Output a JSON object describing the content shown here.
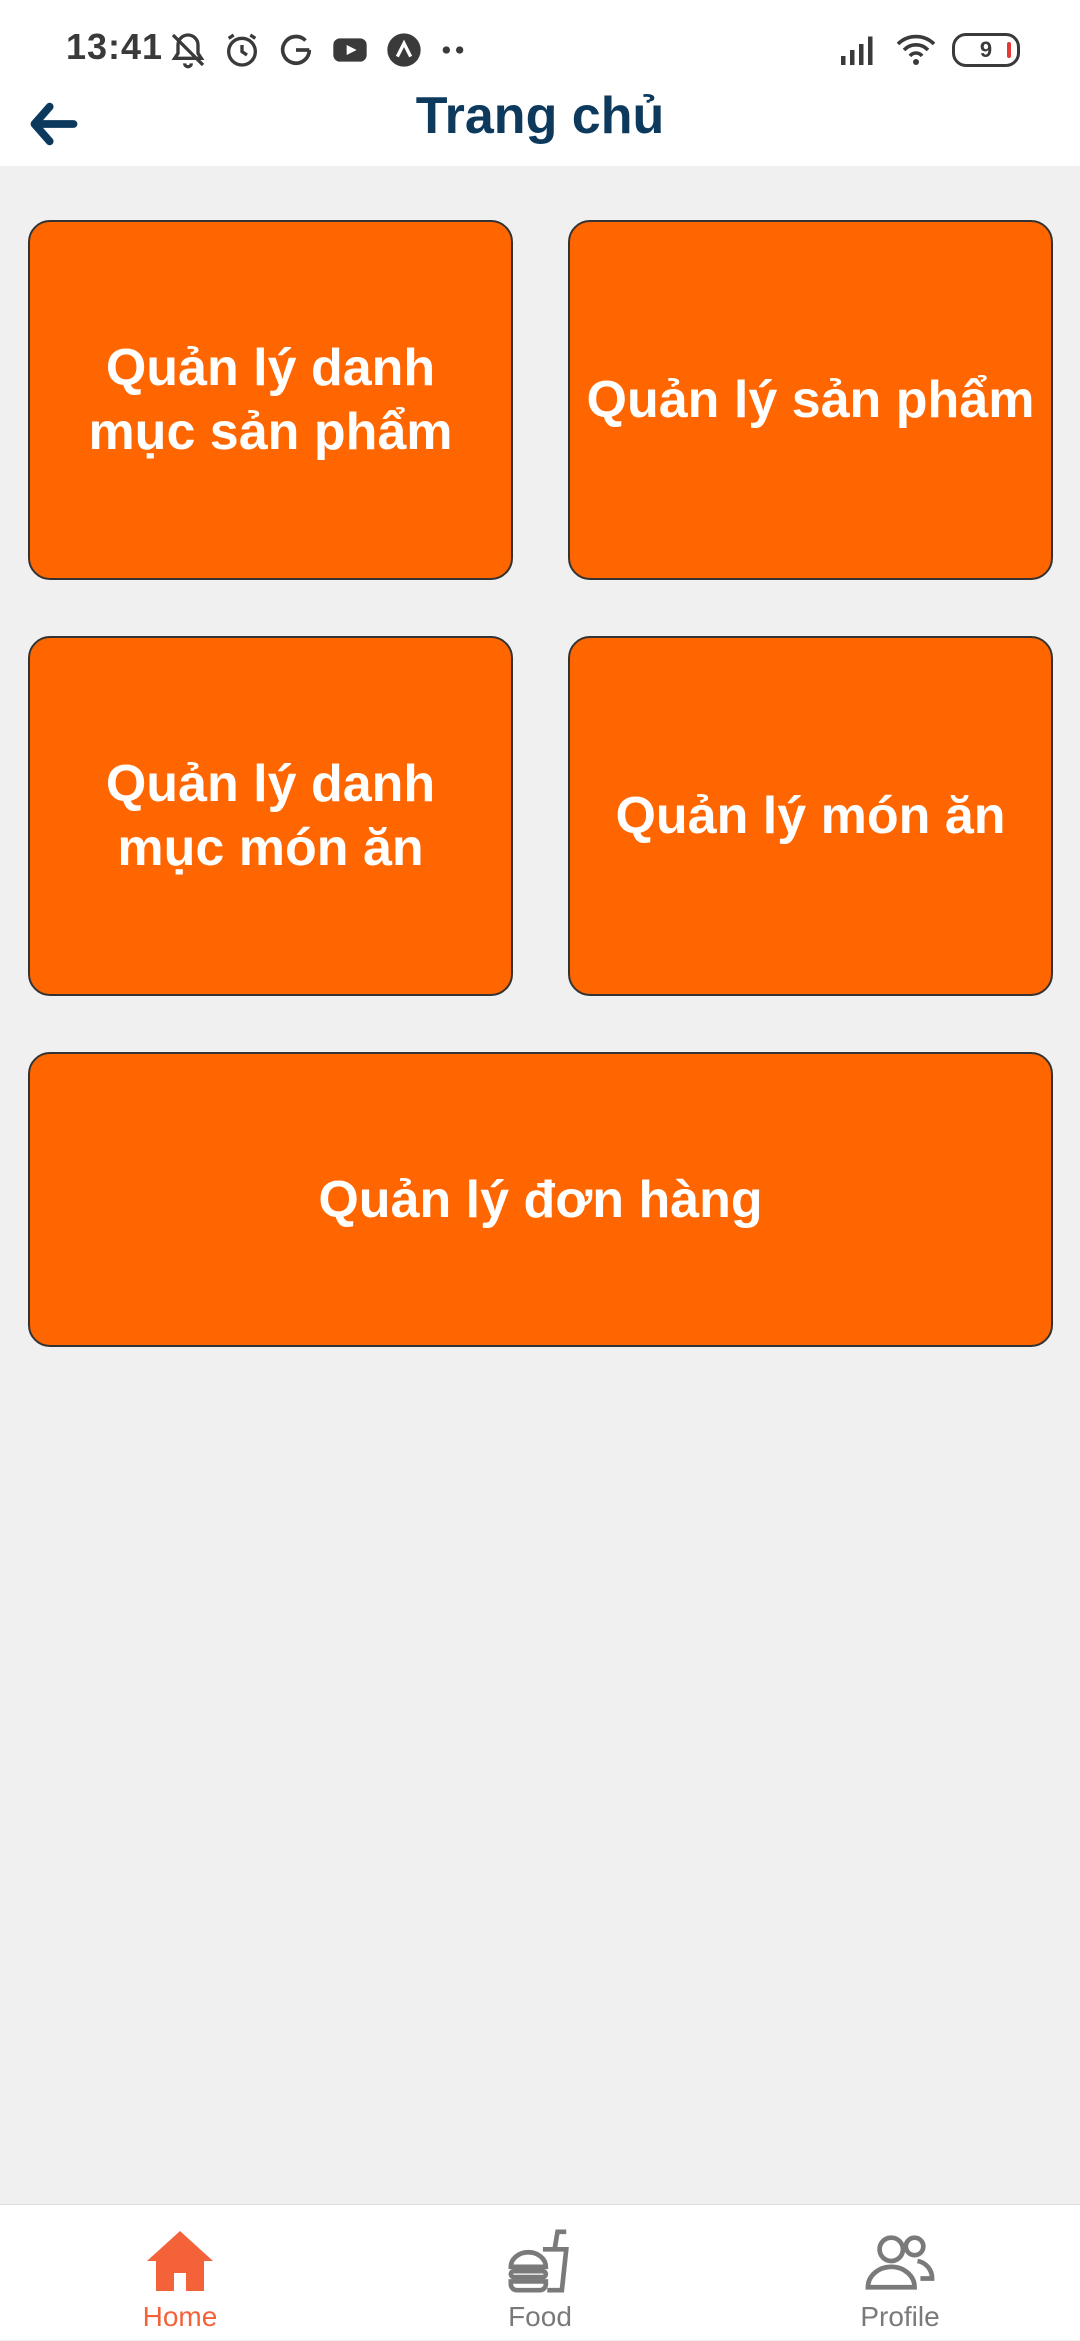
{
  "status_bar": {
    "time": "13:41",
    "battery_level": "9",
    "icons_left": [
      "bell-off-icon",
      "alarm-icon",
      "g-icon",
      "youtube-icon",
      "app-icon",
      "more-dots-icon"
    ],
    "icons_right": [
      "signal-icon",
      "wifi-icon",
      "battery-icon"
    ]
  },
  "header": {
    "title": "Trang chủ",
    "back_icon": "arrow-left-icon"
  },
  "colors": {
    "tile_background": "#ff6600",
    "title_color": "#0d3a5c",
    "active_nav": "#f4623a",
    "inactive_nav": "#7a7a7a"
  },
  "tiles": [
    {
      "label": "Quản lý danh mục sản phẩm"
    },
    {
      "label": "Quản lý sản phẩm"
    },
    {
      "label": "Quản lý danh mục món ăn"
    },
    {
      "label": "Quản lý món ăn"
    },
    {
      "label": "Quản lý đơn hàng"
    }
  ],
  "bottom_nav": {
    "items": [
      {
        "label": "Home",
        "icon": "home-icon",
        "active": true
      },
      {
        "label": "Food",
        "icon": "food-icon",
        "active": false
      },
      {
        "label": "Profile",
        "icon": "profile-icon",
        "active": false
      }
    ]
  }
}
